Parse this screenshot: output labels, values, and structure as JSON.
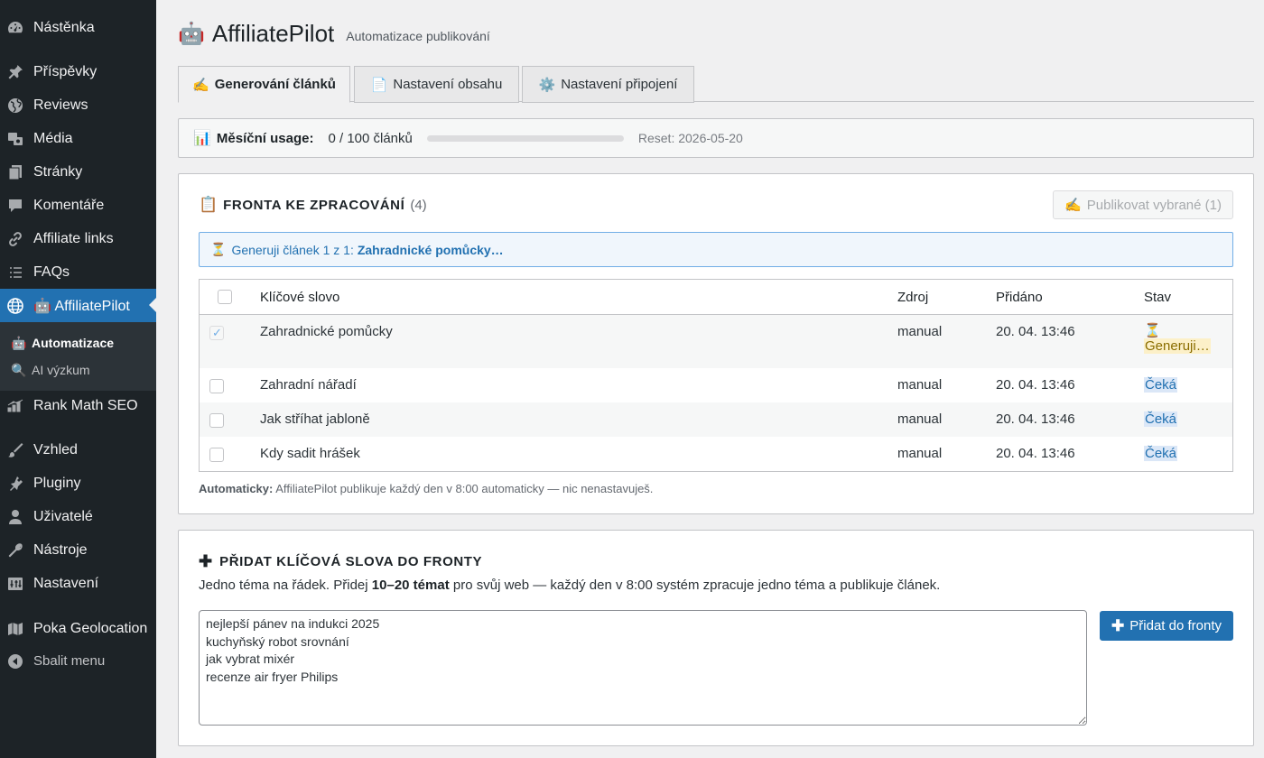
{
  "sidebar": {
    "items": [
      {
        "label": "Nástěnka",
        "icon": "dashboard-icon"
      },
      {
        "label": "Příspěvky",
        "icon": "pin-icon"
      },
      {
        "label": "Reviews",
        "icon": "globe-icon"
      },
      {
        "label": "Média",
        "icon": "media-icon"
      },
      {
        "label": "Stránky",
        "icon": "pages-icon"
      },
      {
        "label": "Komentáře",
        "icon": "comment-icon"
      },
      {
        "label": "Affiliate links",
        "icon": "link-icon"
      },
      {
        "label": "FAQs",
        "icon": "list-icon"
      },
      {
        "label": "AffiliatePilot",
        "icon": "globe-icon",
        "emoji": "🤖"
      },
      {
        "label": "Rank Math SEO",
        "icon": "chart-icon"
      },
      {
        "label": "Vzhled",
        "icon": "brush-icon"
      },
      {
        "label": "Pluginy",
        "icon": "plugin-icon"
      },
      {
        "label": "Uživatelé",
        "icon": "user-icon"
      },
      {
        "label": "Nástroje",
        "icon": "wrench-icon"
      },
      {
        "label": "Nastavení",
        "icon": "settings-icon"
      },
      {
        "label": "Poka Geolocation",
        "icon": "map-icon"
      },
      {
        "label": "Sbalit menu",
        "icon": "collapse-icon"
      }
    ],
    "submenu": [
      {
        "label": "Automatizace",
        "emoji": "🤖"
      },
      {
        "label": "AI výzkum",
        "emoji": "🔍"
      }
    ]
  },
  "header": {
    "emoji": "🤖",
    "title": "AffiliatePilot",
    "subtitle": "Automatizace publikování"
  },
  "tabs": [
    {
      "emoji": "✍️",
      "label": "Generování článků"
    },
    {
      "emoji": "📄",
      "label": "Nastavení obsahu"
    },
    {
      "emoji": "⚙️",
      "label": "Nastavení připojení"
    }
  ],
  "usage": {
    "emoji": "📊",
    "label": "Měsíční usage:",
    "value": "0 / 100 článků",
    "progress_fraction": 0,
    "reset": "Reset: 2026-05-20"
  },
  "queue": {
    "emoji": "📋",
    "title": "FRONTA KE ZPRACOVÁNÍ",
    "count": "(4)",
    "publish_emoji": "✍️",
    "publish_label": "Publikovat vybrané (1)",
    "notice_emoji": "⏳",
    "notice_text": "Generuji článek 1 z 1:",
    "notice_strong": "Zahradnické pomůcky…",
    "columns": [
      "Klíčové slovo",
      "Zdroj",
      "Přidáno",
      "Stav"
    ],
    "rows": [
      {
        "keyword": "Zahradnické pomůcky",
        "source": "manual",
        "added": "20. 04. 13:46",
        "status": "Generuji…",
        "status_emoji": "⏳",
        "checked": true
      },
      {
        "keyword": "Zahradní nářadí",
        "source": "manual",
        "added": "20. 04. 13:46",
        "status": "Čeká",
        "checked": false
      },
      {
        "keyword": "Jak stříhat jabloně",
        "source": "manual",
        "added": "20. 04. 13:46",
        "status": "Čeká",
        "checked": false
      },
      {
        "keyword": "Kdy sadit hrášek",
        "source": "manual",
        "added": "20. 04. 13:46",
        "status": "Čeká",
        "checked": false
      }
    ],
    "auto_label": "Automaticky:",
    "auto_text": "AffiliatePilot publikuje každý den v 8:00 automaticky — nic nenastavuješ."
  },
  "add": {
    "plus": "✚",
    "title": "PŘIDAT KLÍČOVÁ SLOVA DO FRONTY",
    "desc_pre": "Jedno téma na řádek. Přidej",
    "desc_strong": "10–20 témat",
    "desc_post": "pro svůj web — každý den v 8:00 systém zpracuje jedno téma a publikuje článek.",
    "textarea_value": "nejlepší pánev na indukci 2025\nkuchyňský robot srovnání\njak vybrat mixér\nrecenze air fryer Philips",
    "button_label": "Přidat do fronty"
  }
}
